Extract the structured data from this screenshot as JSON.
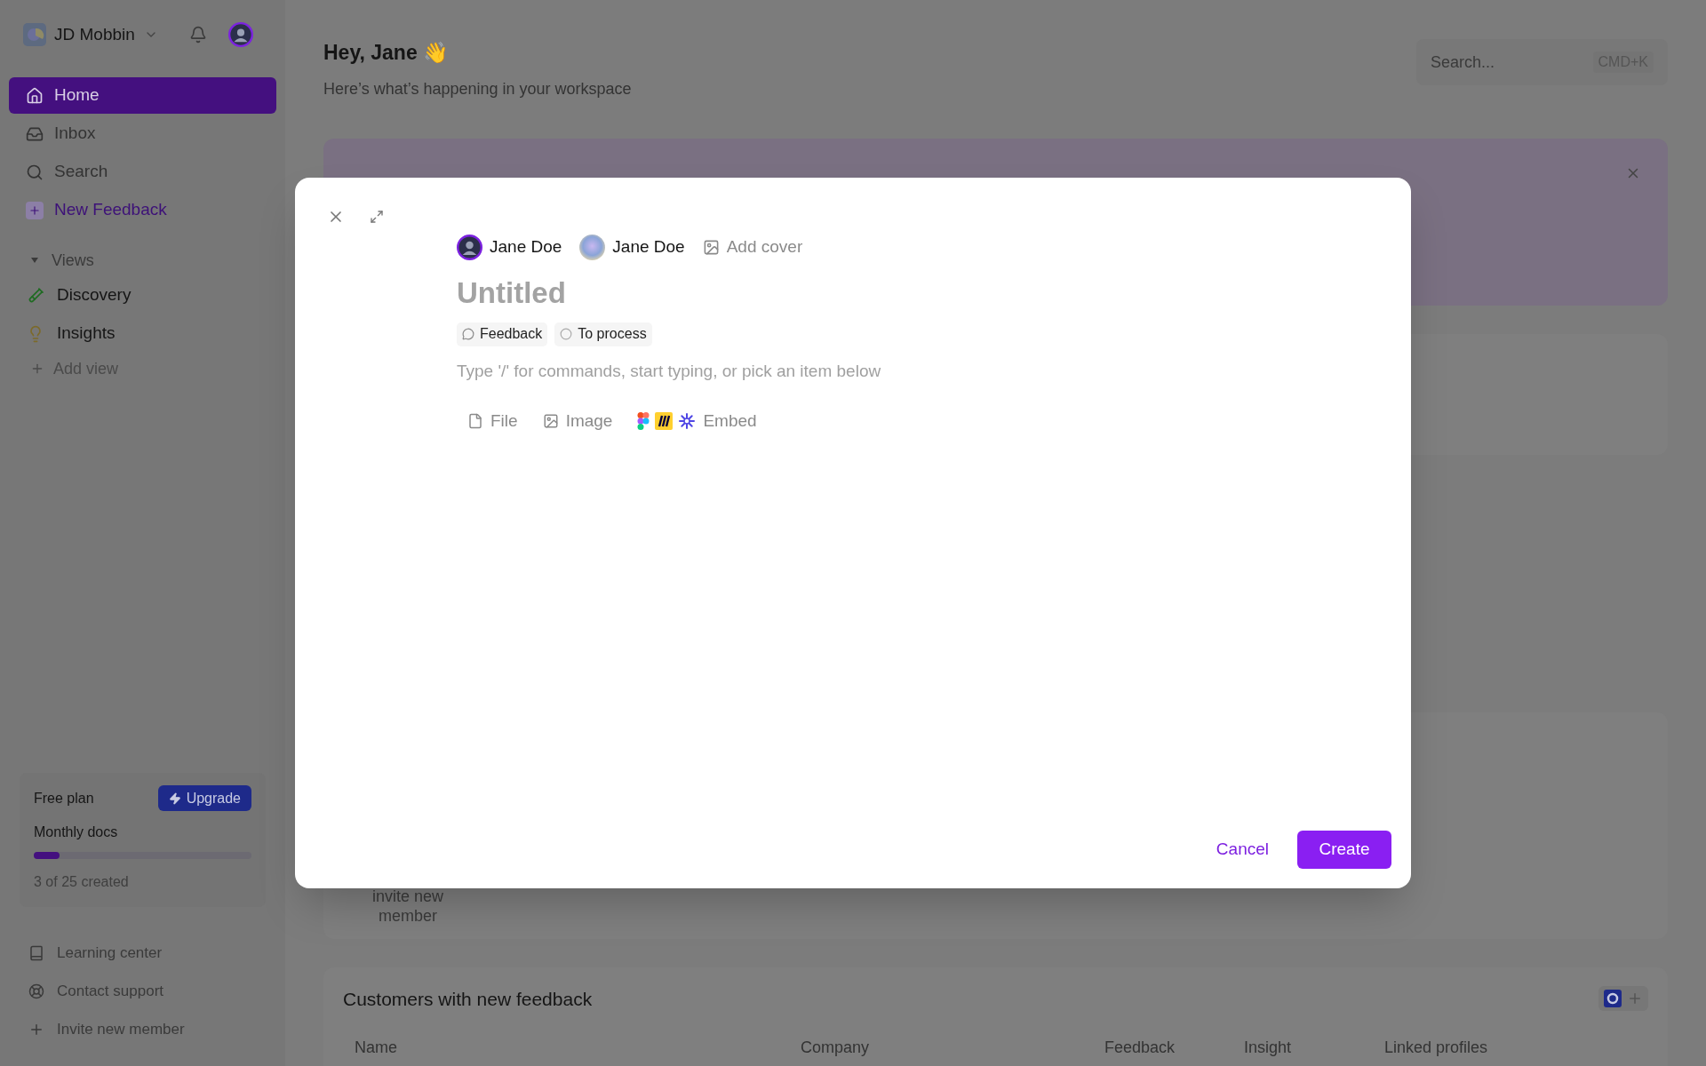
{
  "sidebar": {
    "workspace": "JD Mobbin",
    "nav": [
      {
        "label": "Home",
        "kind": "home",
        "selected": true
      },
      {
        "label": "Inbox",
        "kind": "inbox",
        "selected": false
      },
      {
        "label": "Search",
        "kind": "search",
        "selected": false
      },
      {
        "label": "New Feedback",
        "kind": "new",
        "selected": false
      }
    ],
    "views_title": "Views",
    "views_expanded": true,
    "views": [
      {
        "label": "Discovery",
        "kind": "experiment"
      },
      {
        "label": "Insights",
        "kind": "idea"
      }
    ],
    "add_view": "Add view",
    "plan": {
      "title": "Free plan",
      "upgrade": "Upgrade",
      "meter_label": "Monthly docs",
      "level": 0.12,
      "caption": "3 of 25 created"
    },
    "footer": [
      {
        "label": "Learning center",
        "kind": "learn"
      },
      {
        "label": "Contact support",
        "kind": "support"
      },
      {
        "label": "Invite new member",
        "kind": "invite"
      }
    ]
  },
  "main": {
    "greeting": "Hey, Jane 👋",
    "subtitle": "Here’s what’s happening in your workspace",
    "search": {
      "placeholder": "Search...",
      "shortcut": "CMD+K"
    },
    "invite_text": "invite new member",
    "customers": {
      "title": "Customers with new feedback",
      "columns": [
        "Name",
        "Company",
        "Feedback",
        "Insight",
        "Linked profiles"
      ]
    }
  },
  "modal": {
    "people": [
      {
        "name": "Jane Doe",
        "kind": "photo"
      },
      {
        "name": "Jane Doe",
        "kind": "gradient"
      }
    ],
    "add_cover": "Add cover",
    "title_placeholder": "Untitled",
    "tags": [
      {
        "label": "Feedback",
        "kind": "type"
      },
      {
        "label": "To process",
        "kind": "status"
      }
    ],
    "editor_placeholder": "Type '/' for commands, start typing, or pick an item below",
    "inserts": [
      {
        "label": "File",
        "kind": "file"
      },
      {
        "label": "Image",
        "kind": "image"
      },
      {
        "label": "Embed",
        "kind": "embed"
      }
    ],
    "cancel": "Cancel",
    "create": "Create"
  }
}
